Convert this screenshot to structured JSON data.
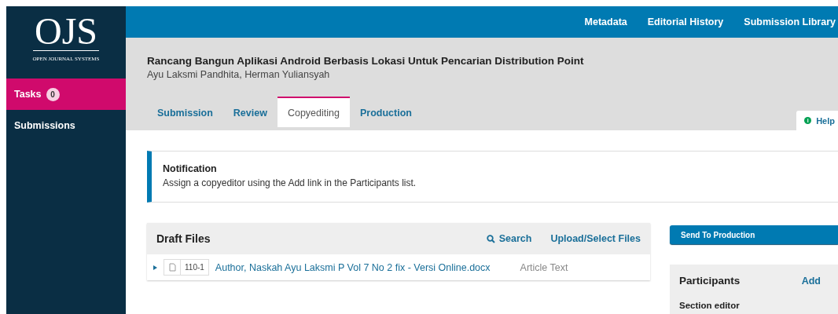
{
  "logo": {
    "mark": "OJS",
    "tagline": "OPEN JOURNAL SYSTEMS"
  },
  "sidebar": {
    "items": [
      {
        "label": "Tasks",
        "badge": "0",
        "selected": true
      },
      {
        "label": "Submissions",
        "selected": false
      }
    ]
  },
  "top_nav": [
    "Metadata",
    "Editorial History",
    "Submission Library"
  ],
  "submission": {
    "title": "Rancang Bangun Aplikasi Android Berbasis Lokasi Untuk Pencarian Distribution Point",
    "authors": "Ayu Laksmi Pandhita, Herman Yuliansyah"
  },
  "tabs": [
    {
      "label": "Submission",
      "selected": false
    },
    {
      "label": "Review",
      "selected": false
    },
    {
      "label": "Copyediting",
      "selected": true
    },
    {
      "label": "Production",
      "selected": false
    }
  ],
  "help": {
    "icon": "i",
    "label": "Help"
  },
  "notification": {
    "title": "Notification",
    "message": "Assign a copyeditor using the Add link in the Participants list."
  },
  "draft_files": {
    "title": "Draft Files",
    "actions": [
      "Search",
      "Upload/Select Files"
    ],
    "rows": [
      {
        "id": "110-1",
        "name": "Author, Naskah Ayu Laksmi P Vol 7 No 2 fix - Versi Online.docx",
        "genre": "Article Text"
      }
    ]
  },
  "send_button": "Send To Production",
  "participants": {
    "title": "Participants",
    "add": "Add",
    "groups": [
      "Section editor"
    ]
  }
}
